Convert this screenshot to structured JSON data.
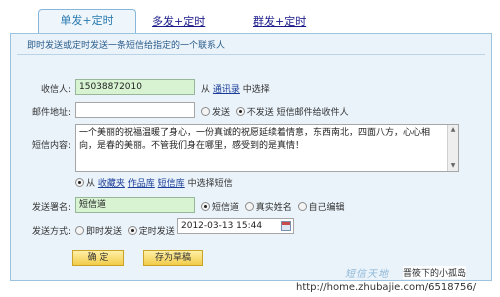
{
  "tabs": {
    "active": "单发+定时",
    "second": "多发+定时",
    "third": "群发+定时"
  },
  "description": "即时发送或定时发送一条短信给指定的一个联系人",
  "recipient": {
    "label": "收信人:",
    "value": "15038872010",
    "from_text": "从",
    "link": "通讯录",
    "suffix": "中选择"
  },
  "email": {
    "label": "邮件地址:",
    "option_send": "发送",
    "option_nosend": "不发送 短信邮件给收件人"
  },
  "content": {
    "label": "短信内容:",
    "value": "一个美丽的祝福温暖了身心，一份真诚的祝愿延续着情意，东西南北，四面八方，心心相向，是春的美丽。不管我们身在哪里，感受到的是真情！",
    "from_text": "从",
    "link1": "收藏夹",
    "link2": "作品库",
    "link3": "短信库",
    "suffix": "中选择短信"
  },
  "signature": {
    "label": "发送署名:",
    "value": "短信道",
    "option1": "短信道",
    "option2": "真实姓名",
    "option3": "自己编辑"
  },
  "send_mode": {
    "label": "发送方式:",
    "option_now": "即时发送",
    "option_timed": "定时发送",
    "datetime": "2012-03-13 15:44"
  },
  "buttons": {
    "ok": "确 定",
    "draft": "存为草稿"
  },
  "watermark": {
    "logo": "短信天地",
    "name": "晋筱下的小孤岛",
    "url": "http://home.zhubajie.com/6518756/"
  }
}
